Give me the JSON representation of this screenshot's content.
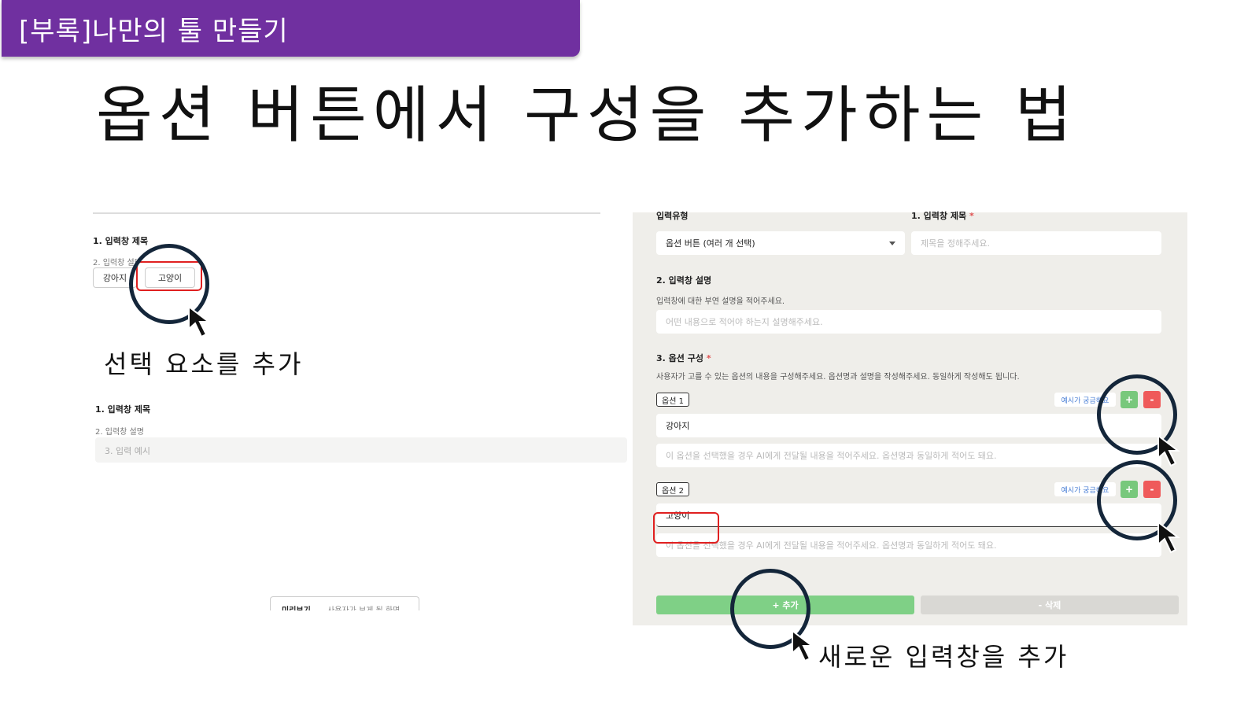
{
  "header": {
    "tag": "[부록]나만의 툴 만들기"
  },
  "slide": {
    "title": "옵션 버튼에서 구성을 추가하는 법"
  },
  "left_preview": {
    "field1_title": "1. 입력창 제목",
    "field1_desc": "2. 입력창 설명",
    "options": [
      "강아지",
      "고양이"
    ],
    "field2_title": "1. 입력창 제목",
    "field2_desc": "2. 입력창 설명",
    "field2_placeholder": "3. 입력 예시",
    "preview_tab": "미리보기",
    "preview_tab_sub": "사용자가 보게 될 화면"
  },
  "editor": {
    "input_type_label": "입력유형",
    "input_type_value": "옵션 버튼 (여러 개 선택)",
    "title_label": "1. 입력창 제목",
    "title_placeholder": "제목을 정해주세요.",
    "desc_label": "2. 입력창 설명",
    "desc_help": "입력창에 대한 부연 설명을 적어주세요.",
    "desc_placeholder": "어떤 내용으로 적어야 하는지 설명해주세요.",
    "options_label": "3. 옵션 구성",
    "options_help": "사용자가 고를 수 있는 옵션의 내용을 구성해주세요. 옵션명과 설명을 작성해주세요. 동일하게 작성해도 됩니다.",
    "required_mark": "*",
    "option_items": [
      {
        "badge": "옵션 1",
        "value": "강아지",
        "desc_placeholder": "이 옵션을 선택했을 경우 AI에게 전달될 내용을 적어주세요. 옵션명과 동일하게 적어도 돼요.",
        "hint": "예시가 궁금해요",
        "plus": "+",
        "minus": "-"
      },
      {
        "badge": "옵션 2",
        "value": "고양이",
        "desc_placeholder": "이 옵션을 선택했을 경우 AI에게 전달될 내용을 적어주세요. 옵션명과 동일하게 적어도 돼요.",
        "hint": "예시가 궁금해요",
        "plus": "+",
        "minus": "-"
      }
    ],
    "add_button": "+ 추가",
    "delete_button": "- 삭제"
  },
  "annotations": {
    "caption_left": "선택 요소를 추가",
    "caption_bottom": "새로운 입력창을 추가"
  },
  "colors": {
    "header": "#7030a0",
    "annotation": "#14263a",
    "highlight": "#e02020",
    "add": "#7fd086",
    "remove": "#ef5a5a"
  },
  "icons": [
    "cursor-arrow-icon",
    "dropdown-arrow-icon"
  ]
}
